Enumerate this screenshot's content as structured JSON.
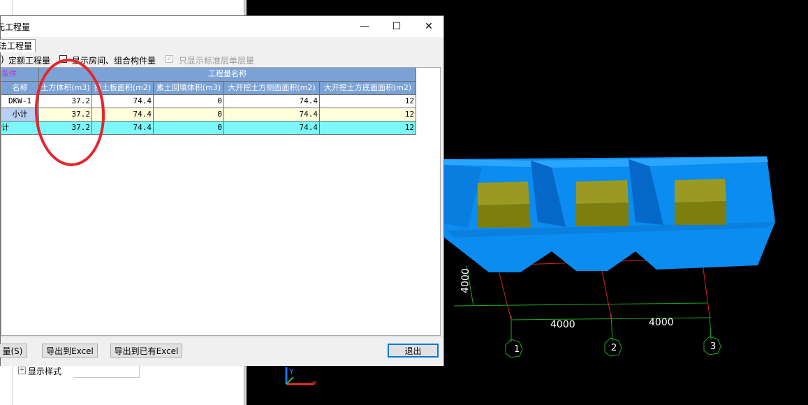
{
  "dialog": {
    "title": "元工程量",
    "tab_label": "法工程量",
    "options": {
      "quota_label": "定额工程量",
      "show_rooms_label": "显示房间、组合构件量",
      "standard_floor_label": "只显示标准层单层量"
    },
    "window_buttons": {
      "minimize": "—",
      "maximize": "☐",
      "close": "✕"
    },
    "table": {
      "cond_header": "条件",
      "group_header": "工程量名称",
      "name_header": "名称",
      "columns": [
        "土方体积(m3)",
        "挡土板面积(m2)",
        "素土回填体积(m3)",
        "大开挖土方侧面面积(m2)",
        "大开挖土方底面面积(m2)"
      ],
      "rows": [
        {
          "name": "DKW-1",
          "values": [
            "37.2",
            "74.4",
            "0",
            "74.4",
            "12"
          ]
        },
        {
          "name": "小计",
          "values": [
            "37.2",
            "74.4",
            "0",
            "74.4",
            "12"
          ]
        },
        {
          "name": "计",
          "values": [
            "37.2",
            "74.4",
            "0",
            "74.4",
            "12"
          ]
        }
      ]
    },
    "buttons": {
      "select_qty": "量(S)",
      "export_excel": "导出到Excel",
      "export_existing_excel": "导出到已有Excel",
      "exit": "退出"
    }
  },
  "left_panel": {
    "display_style_label": "显示样式"
  },
  "viewport": {
    "dim_vertical": "4000",
    "dim_left": "4000",
    "dim_right": "4000",
    "axis_1": "1",
    "axis_2": "2",
    "axis_3": "3",
    "ucs_y": "Y"
  },
  "colors": {
    "header_blue": "#7aa2d6",
    "subtotal_yellow": "#ffffdc",
    "total_cyan": "#7cf8fb",
    "excavation_blue": "#0a8cf0",
    "footing_olive": "#8a8a10",
    "annotation_red": "#e8252b"
  }
}
